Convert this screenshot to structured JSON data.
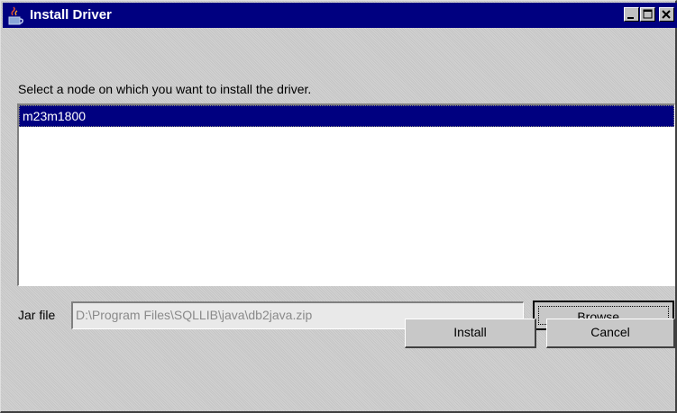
{
  "window": {
    "title": "Install Driver",
    "app_icon": "java-coffee-icon",
    "controls": {
      "minimize_icon": "minimize-icon",
      "maximize_icon": "maximize-icon",
      "close_icon": "close-icon"
    }
  },
  "main": {
    "prompt": "Select a node on which you want to install the driver.",
    "nodes": [
      {
        "label": "m23m1800",
        "selected": true
      }
    ],
    "jar_file": {
      "label": "Jar file",
      "value": "D:\\Program Files\\SQLLIB\\java\\db2java.zip"
    },
    "browse_label": "Browse...",
    "install_label": "Install",
    "cancel_label": "Cancel"
  },
  "colors": {
    "titlebar": "#000080",
    "selection": "#000080",
    "dialog_bg": "#cdcdcd"
  }
}
